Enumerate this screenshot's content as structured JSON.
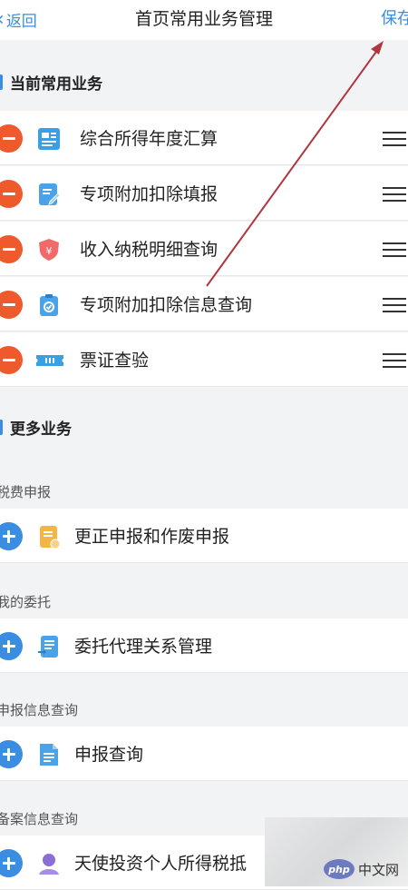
{
  "nav": {
    "back_label": "返回",
    "title": "首页常用业务管理",
    "save_label": "保存"
  },
  "current": {
    "title": "当前常用业务",
    "items": [
      {
        "label": "综合所得年度汇算",
        "icon": "chart-icon"
      },
      {
        "label": "专项附加扣除填报",
        "icon": "edit-document-icon"
      },
      {
        "label": "收入纳税明细查询",
        "icon": "shield-icon"
      },
      {
        "label": "专项附加扣除信息查询",
        "icon": "clipboard-check-icon"
      },
      {
        "label": "票证查验",
        "icon": "ticket-icon"
      }
    ]
  },
  "more": {
    "title": "更多业务",
    "groups": [
      {
        "label": "税费申报",
        "items": [
          {
            "label": "更正申报和作废申报",
            "icon": "document-stamp-icon"
          }
        ]
      },
      {
        "label": "我的委托",
        "items": [
          {
            "label": "委托代理关系管理",
            "icon": "document-arrow-icon"
          }
        ]
      },
      {
        "label": "申报信息查询",
        "items": [
          {
            "label": "申报查询",
            "icon": "document-icon"
          }
        ]
      },
      {
        "label": "备案信息查询",
        "items": [
          {
            "label": "天使投资个人所得税抵",
            "icon": "user-icon"
          }
        ]
      }
    ]
  },
  "watermark": {
    "logo": "php",
    "site_cn": "中文网"
  },
  "colors": {
    "accent": "#3a8de0",
    "remove": "#ee5a2b",
    "annotation_arrow": "#b0363f"
  }
}
